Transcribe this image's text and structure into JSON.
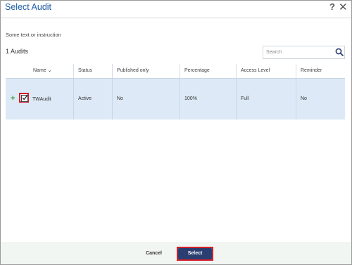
{
  "dialog": {
    "title": "Select Audit",
    "help_label": "?",
    "close_label": "✕"
  },
  "instruction": "Some text or instruction",
  "count_label": "1 Audits",
  "search": {
    "placeholder": "Search"
  },
  "table": {
    "columns": [
      "Name",
      "Status",
      "Published only",
      "Percentage",
      "Access Level",
      "Reminder"
    ],
    "sort_indicator": "⌄",
    "rows": [
      {
        "expander": "+",
        "checked": true,
        "name": "TWAudit",
        "status": "Active",
        "published_only": "No",
        "percentage": "100%",
        "access_level": "Full",
        "reminder": "No"
      }
    ]
  },
  "footer": {
    "cancel_label": "Cancel",
    "select_label": "Select"
  },
  "colors": {
    "title": "#1f5da8",
    "row_selected": "#dde9f6",
    "highlight_border": "#d21f2a",
    "primary_button": "#2b3e72",
    "expander": "#3a9a3a"
  }
}
